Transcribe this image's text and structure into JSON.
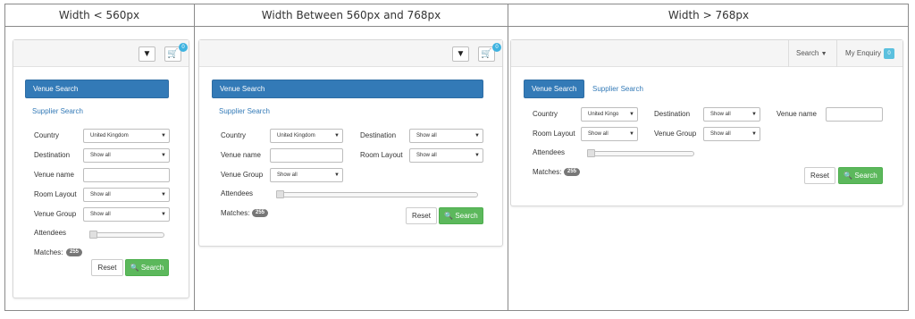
{
  "headers": [
    "Width < 560px",
    "Width Between 560px and 768px",
    "Width > 768px"
  ],
  "cart_count": "0",
  "nav": {
    "search": "Search",
    "enquiry": "My Enquiry",
    "enquiry_count": "0"
  },
  "tabs": {
    "venue": "Venue Search",
    "supplier": "Supplier Search"
  },
  "fields": {
    "country": "Country",
    "destination": "Destination",
    "venue_name": "Venue name",
    "room_layout": "Room Layout",
    "venue_group": "Venue Group",
    "attendees": "Attendees",
    "matches": "Matches:"
  },
  "values": {
    "country": "United Kingdom",
    "country_short": "United Kingo",
    "show_all": "Show all",
    "matches_count": "255"
  },
  "buttons": {
    "reset": "Reset",
    "search": "Search"
  },
  "icons": {
    "chevron": "chevron-down-icon",
    "cart": "shopping-cart-icon",
    "search": "search-icon"
  },
  "colors": {
    "primary": "#337ab7",
    "success": "#5cb85c",
    "info": "#5bc0de"
  }
}
